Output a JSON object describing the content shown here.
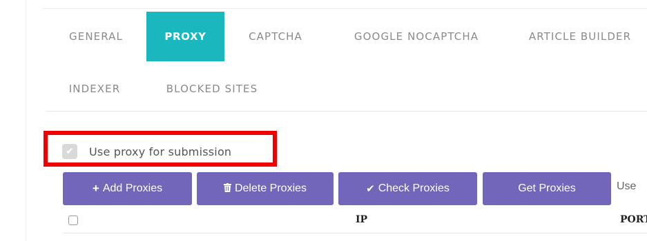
{
  "tabs": {
    "general": "GENERAL",
    "proxy": "PROXY",
    "captcha": "CAPTCHA",
    "google_nocaptcha": "GOOGLE NOCAPTCHA",
    "article_builder": "ARTICLE BUILDER",
    "indexer": "INDEXER",
    "blocked_sites": "BLOCKED SITES",
    "active": "PROXY"
  },
  "proxy_settings": {
    "use_proxy_label": "Use proxy for submission",
    "use_proxy_checked": true
  },
  "toolbar": {
    "add_label": "Add Proxies",
    "delete_label": "Delete Proxies",
    "check_label": "Check Proxies",
    "get_label": "Get Proxies",
    "use_partial": "Use"
  },
  "icons": {
    "add": "plus-icon",
    "delete": "trash-icon",
    "check": "check-icon",
    "checkbox": "checkmark-icon"
  },
  "table": {
    "columns": [
      "IP",
      "PORT"
    ]
  },
  "colors": {
    "accent_teal": "#1ab7bf",
    "button_purple": "#7266ba",
    "highlight_red": "#f00000"
  }
}
